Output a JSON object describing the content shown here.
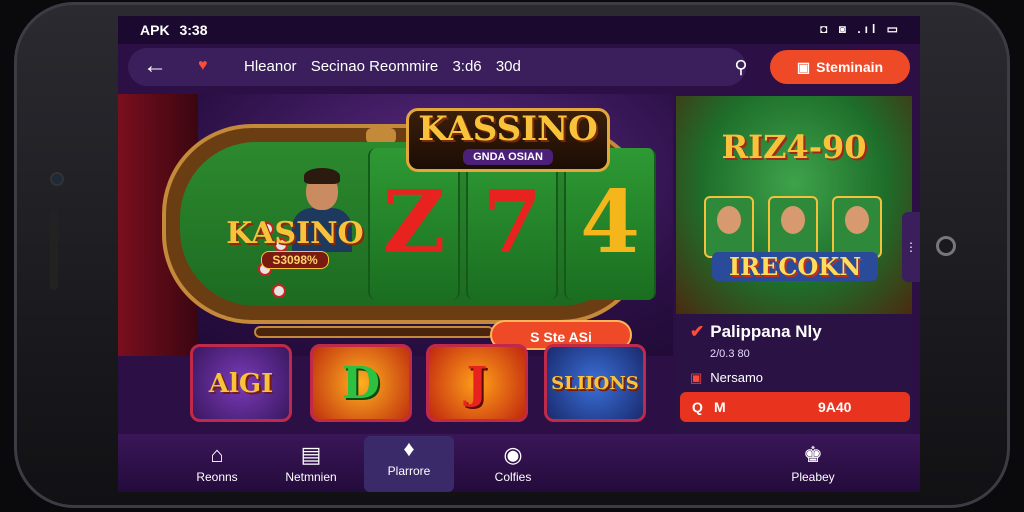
{
  "statusbar": {
    "brand": "APK",
    "time": "3:38",
    "icons": "◘ ◙ .ıl ▭"
  },
  "header": {
    "back_icon": "arrow-left-icon",
    "breadcrumb": [
      "Hleanor",
      "Secinao Reommire",
      "3:d6",
      "30d"
    ],
    "search_icon": "search-icon",
    "cta_label": "Steminain",
    "share_icon": "share-icon"
  },
  "slot": {
    "title": "KASSINO",
    "subtitle": "GNDA OSIAN",
    "reels": [
      "Z",
      "7",
      "4"
    ],
    "small_title": "KASINO",
    "small_sub": "S3098%",
    "spin_label": "S Ste ASi"
  },
  "promo": {
    "title": "RIZ4-90",
    "subtitle": "IRECOKN",
    "name": "Palippana Nly",
    "number": "2/0.3 80",
    "meta": "Nersamo",
    "button_a": "Q",
    "button_b": "M",
    "button_c": "9A40"
  },
  "tiles": [
    "AlGI",
    "D",
    "J",
    "SLIIONS"
  ],
  "nav": {
    "items": [
      {
        "label": "Reonns",
        "icon": "home-icon"
      },
      {
        "label": "Netmnien",
        "icon": "folder-icon"
      },
      {
        "label": "Plarrore",
        "icon": "game-icon"
      },
      {
        "label": "Colfies",
        "icon": "chat-icon"
      },
      {
        "label": "Pleabey",
        "icon": "crown-icon"
      }
    ]
  },
  "colors": {
    "accent": "#ee4a28",
    "background": "#2b0f45",
    "gold": "#f8c33a"
  }
}
